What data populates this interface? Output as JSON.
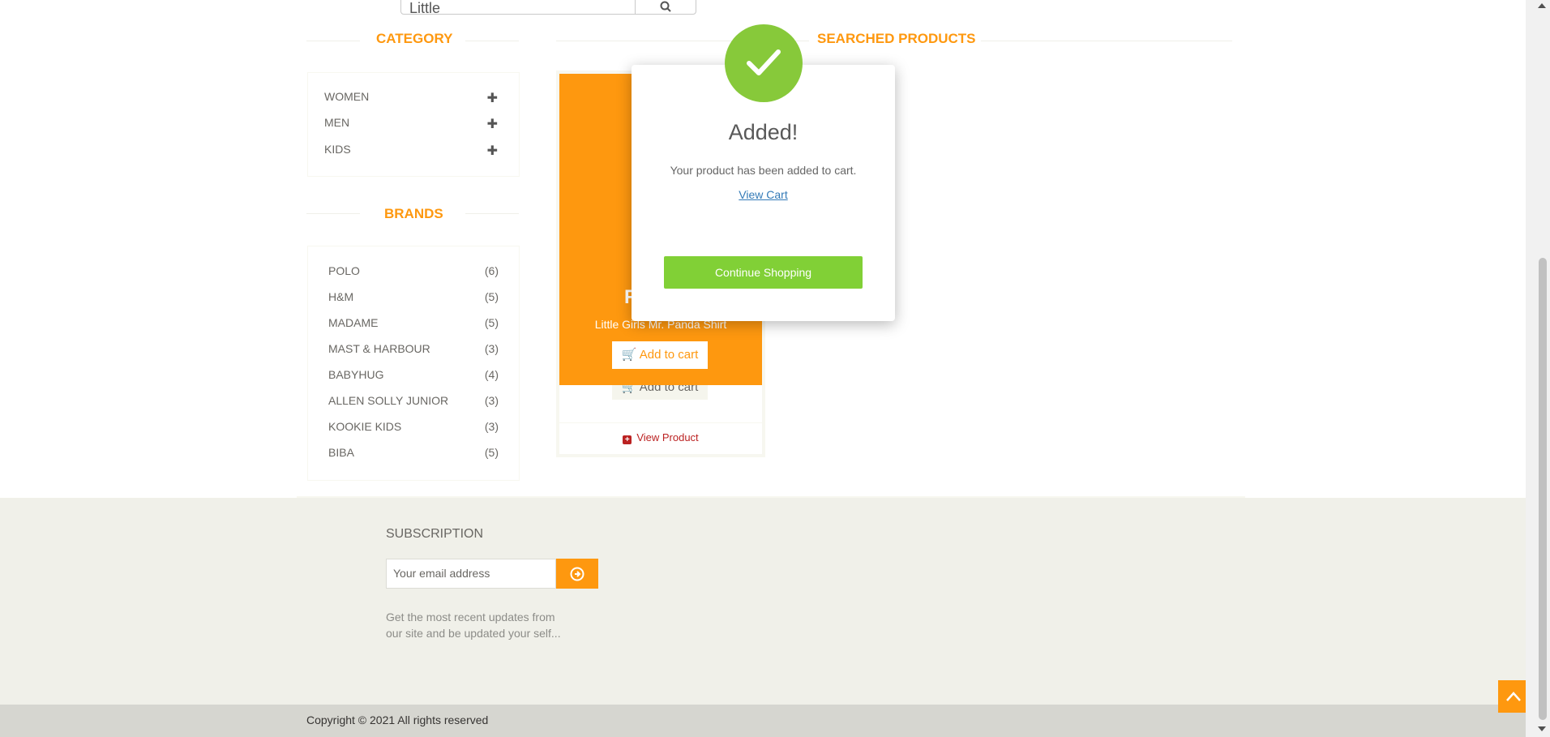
{
  "search": {
    "value": "Little"
  },
  "sidebar": {
    "category_title": "CATEGORY",
    "categories": [
      {
        "label": "WOMEN",
        "icon": "plus-icon"
      },
      {
        "label": "MEN",
        "icon": "plus-icon"
      },
      {
        "label": "KIDS",
        "icon": "plus-icon"
      }
    ],
    "brands_title": "BRANDS",
    "brands": [
      {
        "name": "POLO",
        "count": "(6)"
      },
      {
        "name": "H&M",
        "count": "(5)"
      },
      {
        "name": "MADAME",
        "count": "(5)"
      },
      {
        "name": "MAST & HARBOUR",
        "count": "(3)"
      },
      {
        "name": "BABYHUG",
        "count": "(4)"
      },
      {
        "name": "ALLEN SOLLY JUNIOR",
        "count": "(3)"
      },
      {
        "name": "KOOKIE KIDS",
        "count": "(3)"
      },
      {
        "name": "BIBA",
        "count": "(5)"
      }
    ]
  },
  "main": {
    "title": "SEARCHED PRODUCTS",
    "product": {
      "price_fragment": "R",
      "name": "Little Girls Mr. Panda Shirt",
      "add_to_cart": "Add to cart",
      "view_product": "View Product"
    }
  },
  "modal": {
    "title": "Added!",
    "message": "Your product has been added to cart.",
    "view_cart": "View Cart",
    "continue": "Continue Shopping"
  },
  "footer": {
    "subscription_title": "SUBSCRIPTION",
    "email_placeholder": "Your email address",
    "description": "Get the most recent updates from our site and be updated your self...",
    "copyright": "Copyright © 2021 All rights reserved"
  },
  "colors": {
    "accent": "#fe980f",
    "success": "#87c93a",
    "button_green": "#81d036",
    "footer_bg": "#f0f0e9"
  }
}
